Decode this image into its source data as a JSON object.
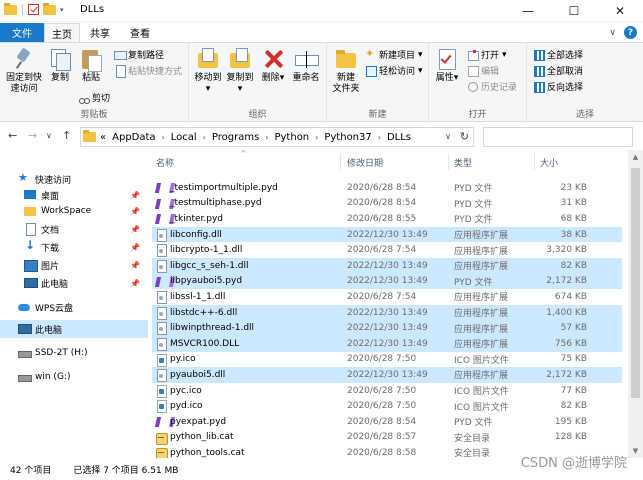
{
  "window": {
    "title": "DLLs",
    "minimize": "—",
    "maximize": "☐",
    "close": "✕",
    "qat_dropdown": "▾"
  },
  "tabs": {
    "file": "文件",
    "home": "主页",
    "share": "共享",
    "view": "查看",
    "collapse": "∨",
    "help": "?"
  },
  "ribbon": {
    "clipboard": {
      "label": "剪贴板",
      "pin": "固定到快速访问",
      "copy": "复制",
      "paste": "粘贴",
      "copy_path": "复制路径",
      "paste_shortcut": "粘贴快捷方式",
      "cut": "剪切"
    },
    "organize": {
      "label": "组织",
      "move_to": "移动到",
      "copy_to": "复制到",
      "delete": "删除",
      "rename": "重命名"
    },
    "new": {
      "label": "新建",
      "new_folder_line1": "新建",
      "new_folder_line2": "文件夹",
      "new_item": "新建项目",
      "easy_access": "轻松访问"
    },
    "open": {
      "label": "打开",
      "properties": "属性",
      "open": "打开",
      "edit": "编辑",
      "history": "历史记录"
    },
    "select": {
      "label": "选择",
      "select_all": "全部选择",
      "select_none": "全部取消",
      "invert": "反向选择"
    },
    "dropdown_arrow": "▾"
  },
  "address": {
    "back": "←",
    "forward": "→",
    "history_dd": "∨",
    "up": "↑",
    "prefix": "«",
    "crumbs": [
      "AppData",
      "Local",
      "Programs",
      "Python",
      "Python37",
      "DLLs"
    ],
    "separator": "›",
    "dropdown": "∨",
    "refresh": "↻"
  },
  "nav": {
    "pin_glyph": "📌",
    "items": [
      {
        "label": "快速访问",
        "icon": "star-icon"
      },
      {
        "label": "桌面",
        "icon": "desktop-icon",
        "pinned": true
      },
      {
        "label": "WorkSpace",
        "icon": "folder-icon",
        "pinned": true
      },
      {
        "label": "文档",
        "icon": "document-icon",
        "pinned": true
      },
      {
        "label": "下载",
        "icon": "download-icon",
        "pinned": true
      },
      {
        "label": "图片",
        "icon": "picture-icon",
        "pinned": true
      },
      {
        "label": "此电脑",
        "icon": "computer-icon",
        "pinned": true
      },
      {
        "label": "WPS云盘",
        "icon": "cloud-icon"
      },
      {
        "label": "此电脑",
        "icon": "computer-icon",
        "selected": true
      },
      {
        "label": "SSD-2T (H:)",
        "icon": "drive-icon"
      },
      {
        "label": "win (G:)",
        "icon": "drive-icon"
      }
    ]
  },
  "columns": {
    "name": "名称",
    "date": "修改日期",
    "type": "类型",
    "size": "大小",
    "sort_glyph": "^"
  },
  "files": [
    {
      "name": "_testimportmultiple.pyd",
      "date": "2020/6/28 8:54",
      "type": "PYD 文件",
      "size": "23 KB",
      "icon": "pyd",
      "selected": false
    },
    {
      "name": "_testmultiphase.pyd",
      "date": "2020/6/28 8:54",
      "type": "PYD 文件",
      "size": "31 KB",
      "icon": "pyd",
      "selected": false
    },
    {
      "name": "_tkinter.pyd",
      "date": "2020/6/28 8:55",
      "type": "PYD 文件",
      "size": "68 KB",
      "icon": "pyd",
      "selected": false
    },
    {
      "name": "libconfig.dll",
      "date": "2022/12/30 13:49",
      "type": "应用程序扩展",
      "size": "38 KB",
      "icon": "dll",
      "selected": true
    },
    {
      "name": "libcrypto-1_1.dll",
      "date": "2020/6/28 7:54",
      "type": "应用程序扩展",
      "size": "3,320 KB",
      "icon": "dll",
      "selected": false
    },
    {
      "name": "libgcc_s_seh-1.dll",
      "date": "2022/12/30 13:49",
      "type": "应用程序扩展",
      "size": "82 KB",
      "icon": "dll",
      "selected": true
    },
    {
      "name": "libpyauboi5.pyd",
      "date": "2022/12/30 13:49",
      "type": "PYD 文件",
      "size": "2,172 KB",
      "icon": "pyd",
      "selected": true
    },
    {
      "name": "libssl-1_1.dll",
      "date": "2020/6/28 7:54",
      "type": "应用程序扩展",
      "size": "674 KB",
      "icon": "dll",
      "selected": false
    },
    {
      "name": "libstdc++-6.dll",
      "date": "2022/12/30 13:49",
      "type": "应用程序扩展",
      "size": "1,400 KB",
      "icon": "dll",
      "selected": true
    },
    {
      "name": "libwinpthread-1.dll",
      "date": "2022/12/30 13:49",
      "type": "应用程序扩展",
      "size": "57 KB",
      "icon": "dll",
      "selected": true
    },
    {
      "name": "MSVCR100.DLL",
      "date": "2022/12/30 13:49",
      "type": "应用程序扩展",
      "size": "756 KB",
      "icon": "dll",
      "selected": true
    },
    {
      "name": "py.ico",
      "date": "2020/6/28 7:50",
      "type": "ICO 图片文件",
      "size": "75 KB",
      "icon": "ico",
      "selected": false
    },
    {
      "name": "pyauboi5.dll",
      "date": "2022/12/30 13:49",
      "type": "应用程序扩展",
      "size": "2,172 KB",
      "icon": "dll",
      "selected": true
    },
    {
      "name": "pyc.ico",
      "date": "2020/6/28 7:50",
      "type": "ICO 图片文件",
      "size": "77 KB",
      "icon": "ico",
      "selected": false
    },
    {
      "name": "pyd.ico",
      "date": "2020/6/28 7:50",
      "type": "ICO 图片文件",
      "size": "82 KB",
      "icon": "ico",
      "selected": false
    },
    {
      "name": "pyexpat.pyd",
      "date": "2020/6/28 8:54",
      "type": "PYD 文件",
      "size": "195 KB",
      "icon": "pyd",
      "selected": false
    },
    {
      "name": "python_lib.cat",
      "date": "2020/6/28 8:57",
      "type": "安全目录",
      "size": "128 KB",
      "icon": "cat",
      "selected": false
    },
    {
      "name": "python_tools.cat",
      "date": "2020/6/28 8:58",
      "type": "安全目录",
      "size": "",
      "icon": "cat",
      "selected": false
    }
  ],
  "scroll": {
    "up": "▲",
    "down": "▼"
  },
  "status": {
    "count": "42 个项目",
    "selection": "已选择 7 个项目  6.51 MB",
    "watermark": "CSDN @逝博学院"
  }
}
